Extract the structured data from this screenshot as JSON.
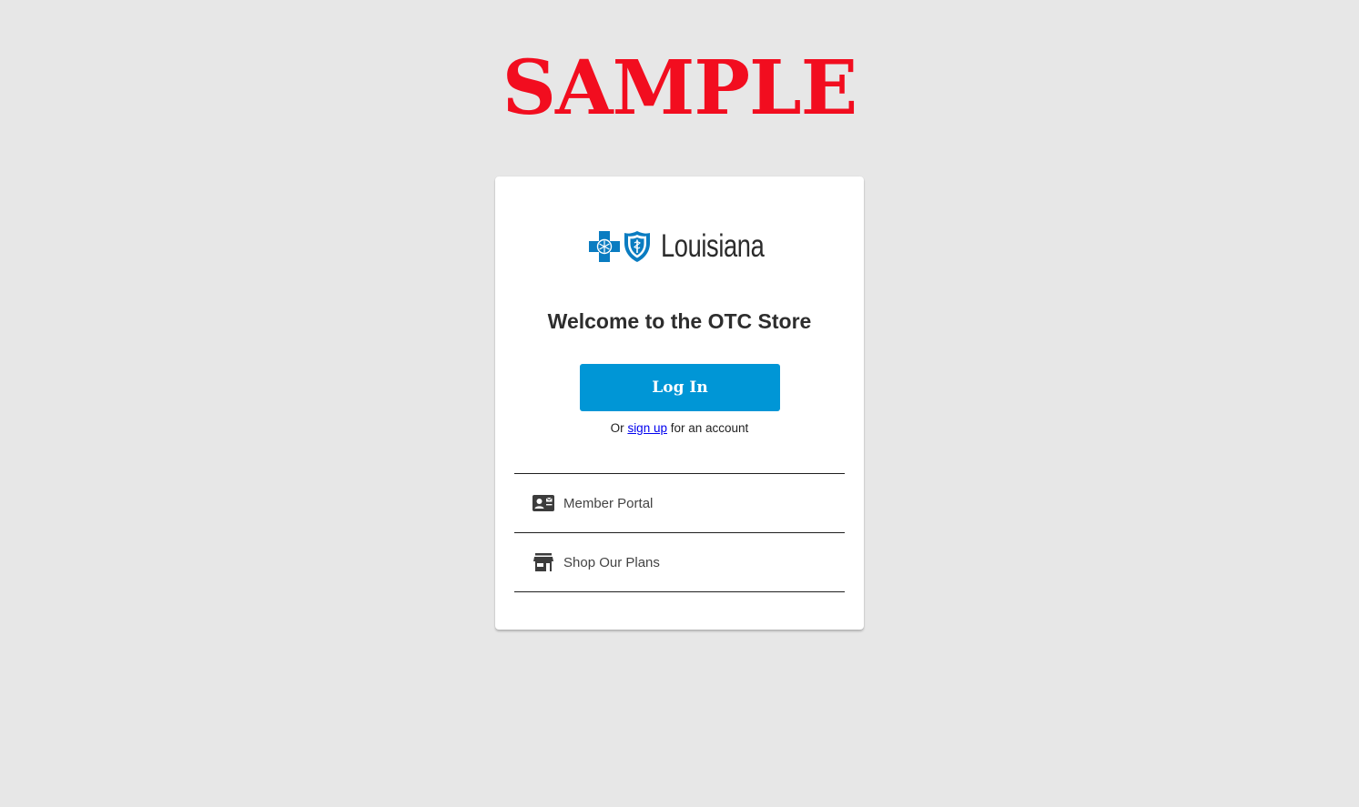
{
  "watermark": "SAMPLE",
  "logo": {
    "text": "Louisiana",
    "brand_color": "#0a7cc1",
    "icons": [
      "blue-cross-icon",
      "blue-shield-icon"
    ]
  },
  "welcome_title": "Welcome to the OTC Store",
  "login_button": {
    "label": "Log In",
    "color": "#0096d6"
  },
  "signup": {
    "prefix": "Or",
    "link_text": "sign up",
    "suffix": "for an account"
  },
  "links": [
    {
      "label": "Member Portal",
      "icon": "contact-card-icon"
    },
    {
      "label": "Shop Our Plans",
      "icon": "storefront-icon"
    }
  ]
}
